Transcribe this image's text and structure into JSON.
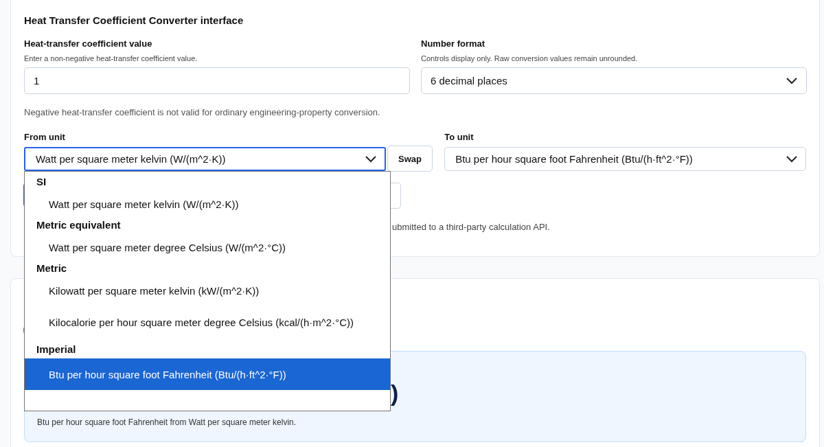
{
  "title": "Heat Transfer Coefficient Converter interface",
  "value_field": {
    "label": "Heat-transfer coefficient value",
    "hint": "Enter a non-negative heat-transfer coefficient value.",
    "value": "1"
  },
  "number_format": {
    "label": "Number format",
    "hint": "Controls display only. Raw conversion values remain unrounded.",
    "value": "6 decimal places"
  },
  "note": "Negative heat-transfer coefficient is not valid for ordinary engineering-property conversion.",
  "from_unit": {
    "label": "From unit",
    "value": "Watt per square meter kelvin (W/(m^2·K))"
  },
  "swap_button": "Swap",
  "to_unit": {
    "label": "To unit",
    "value": "Btu per hour square foot Fahrenheit (Btu/(h·ft^2·°F))"
  },
  "dropdown": {
    "groups": [
      {
        "label": "SI",
        "options": [
          {
            "label": "Watt per square meter kelvin (W/(m^2·K))",
            "selected": false
          }
        ]
      },
      {
        "label": "Metric equivalent",
        "options": [
          {
            "label": "Watt per square meter degree Celsius (W/(m^2·°C))",
            "selected": false
          }
        ]
      },
      {
        "label": "Metric",
        "options": [
          {
            "label": "Kilowatt per square meter kelvin (kW/(m^2·K))",
            "selected": false
          },
          {
            "label": "Kilocalorie per hour square meter degree Celsius (kcal/(h·m^2·°C))",
            "selected": false
          }
        ]
      },
      {
        "label": "Imperial",
        "options": [
          {
            "label": "Btu per hour square foot Fahrenheit (Btu/(h·ft^2·°F))",
            "selected": true
          }
        ]
      }
    ]
  },
  "api_note": "ubmitted to a third-party calculation API.",
  "result": {
    "value": ")",
    "caption": "Btu per hour square foot Fahrenheit from Watt per square meter kelvin."
  }
}
